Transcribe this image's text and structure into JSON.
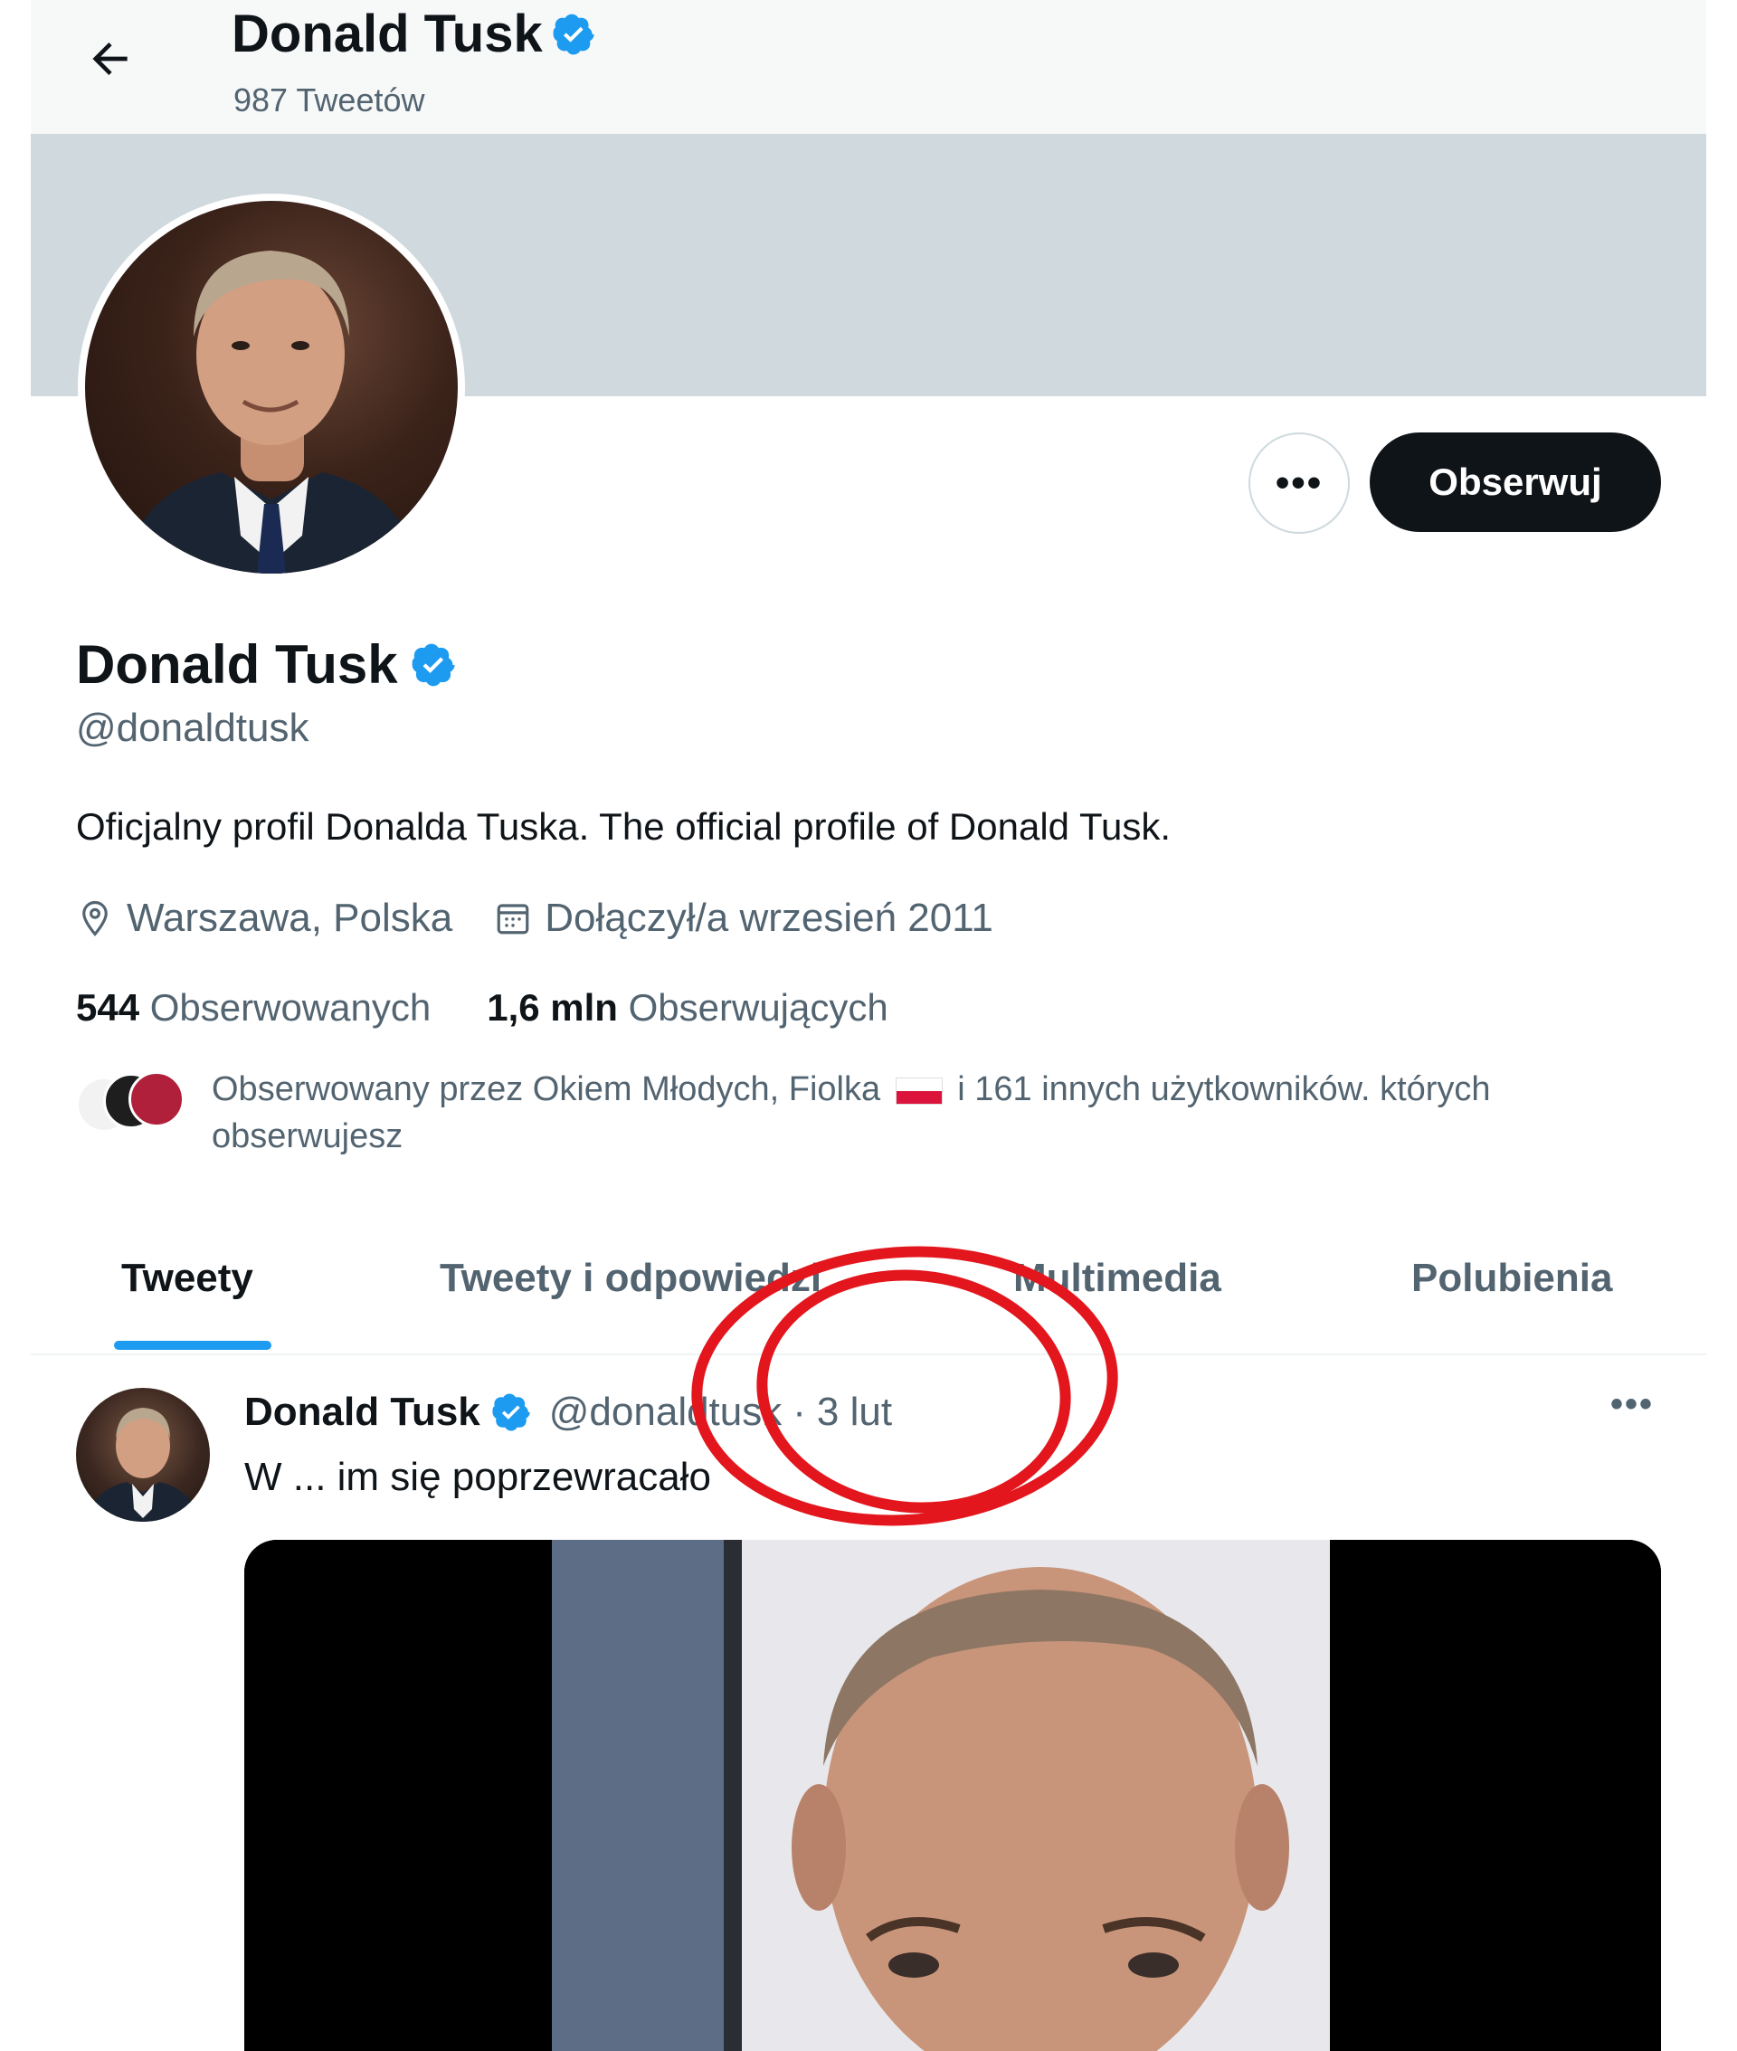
{
  "header": {
    "name": "Donald Tusk",
    "tweet_count": "987 Tweetów"
  },
  "actions": {
    "more_label": "•••",
    "follow_label": "Obserwuj"
  },
  "profile": {
    "name": "Donald Tusk",
    "handle": "@donaldtusk",
    "bio": "Oficjalny profil Donalda Tuska. The official profile of Donald Tusk.",
    "location": "Warszawa, Polska",
    "joined": "Dołączył/a wrzesień 2011",
    "following_count": "544",
    "following_label": "Obserwowanych",
    "followers_count": "1,6 mln",
    "followers_label": "Obserwujących",
    "followed_by_prefix": "Obserwowany przez Okiem Młodych, Fiolka",
    "followed_by_suffix": "i 161 innych użytkowników. których obserwujesz"
  },
  "tabs": [
    {
      "label": "Tweety",
      "active": true
    },
    {
      "label": "Tweety i odpowiedzi",
      "active": false
    },
    {
      "label": "Multimedia",
      "active": false
    },
    {
      "label": "Polubienia",
      "active": false
    }
  ],
  "tweet": {
    "author": "Donald Tusk",
    "handle": "@donaldtusk",
    "separator": "·",
    "time": "3 lut",
    "text": "W ... im się poprzewracało",
    "more_label": "•••"
  },
  "colors": {
    "accent": "#1d9bf0",
    "annotation": "#e3161d"
  },
  "icons": [
    "back-arrow-icon",
    "verified-badge-icon",
    "location-pin-icon",
    "calendar-icon",
    "more-icon",
    "poland-flag-icon"
  ]
}
